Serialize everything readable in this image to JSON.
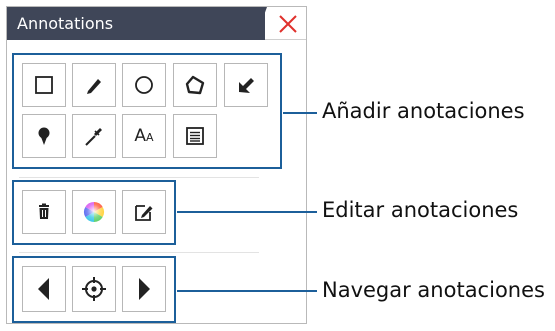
{
  "panel": {
    "title": "Annotations",
    "close_icon": "close-x-icon",
    "close_color": "#e0312c",
    "title_bg": "#3f4658",
    "accent": "#1c5f9a"
  },
  "groups": {
    "add": {
      "label": "Añadir anotaciones",
      "tools": [
        {
          "name": "rectangle-tool",
          "icon": "rectangle-icon"
        },
        {
          "name": "pencil-tool",
          "icon": "pencil-icon"
        },
        {
          "name": "ellipse-tool",
          "icon": "circle-icon"
        },
        {
          "name": "polygon-tool",
          "icon": "polygon-icon"
        },
        {
          "name": "arrow-tool",
          "icon": "arrow-icon"
        },
        {
          "name": "pin-tool",
          "icon": "pin-icon"
        },
        {
          "name": "ruler-tool",
          "icon": "ruler-icon"
        },
        {
          "name": "text-tool",
          "icon": "text-icon",
          "text": "AA"
        },
        {
          "name": "note-tool",
          "icon": "note-icon"
        }
      ]
    },
    "edit": {
      "label": "Editar anotaciones",
      "tools": [
        {
          "name": "delete-tool",
          "icon": "trash-icon"
        },
        {
          "name": "color-tool",
          "icon": "color-wheel-icon"
        },
        {
          "name": "edit-tool",
          "icon": "edit-icon"
        }
      ]
    },
    "navigate": {
      "label": "Navegar anotaciones",
      "tools": [
        {
          "name": "previous-annotation",
          "icon": "triangle-left-icon"
        },
        {
          "name": "focus-annotation",
          "icon": "crosshair-icon"
        },
        {
          "name": "next-annotation",
          "icon": "triangle-right-icon"
        }
      ]
    }
  }
}
